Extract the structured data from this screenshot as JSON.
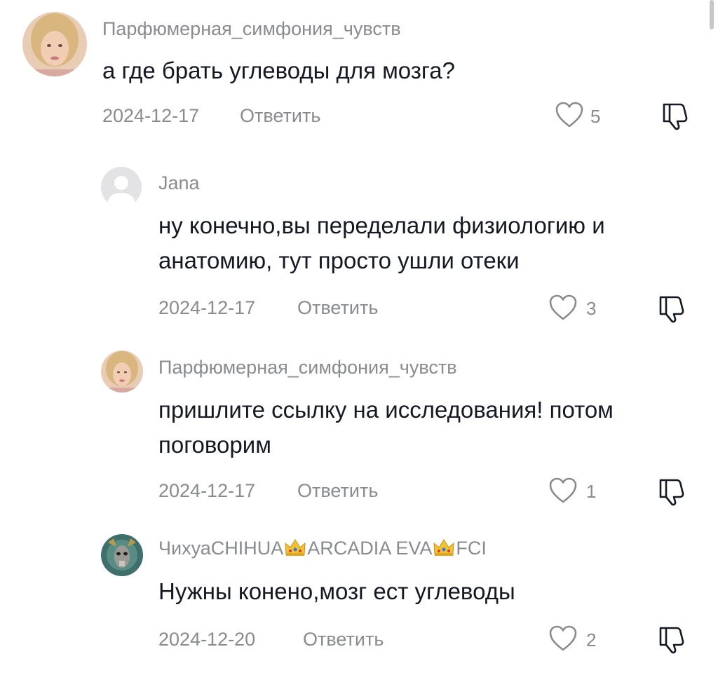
{
  "comments": [
    {
      "username": "Парфюмерная_симфония_чувств",
      "text": "а где брать углеводы для мозга?",
      "date": "2024-12-17",
      "reply_label": "Ответить",
      "likes": "5",
      "like_icon": "heart-outline-icon",
      "dislike_icon": "thumbs-down-icon"
    },
    {
      "username": "Jana",
      "text": "ну конечно,вы переделали физиологию и анатомию, тут просто ушли отеки",
      "date": "2024-12-17",
      "reply_label": "Ответить",
      "likes": "3",
      "like_icon": "heart-outline-icon",
      "dislike_icon": "thumbs-down-icon"
    },
    {
      "username": "Парфюмерная_симфония_чувств",
      "text": "пришлите ссылку на исследования! потом поговорим",
      "date": "2024-12-17",
      "reply_label": "Ответить",
      "likes": "1",
      "like_icon": "heart-outline-icon",
      "dislike_icon": "thumbs-down-icon"
    },
    {
      "username_parts": [
        "ЧихуаCHIHUA",
        "ARCADIA EVA",
        "FCI"
      ],
      "username_icon": "crown-emoji-icon",
      "text": "Нужны конено,мозг ест углеводы",
      "date": "2024-12-20",
      "reply_label": "Ответить",
      "likes": "2",
      "like_icon": "heart-outline-icon",
      "dislike_icon": "thumbs-down-icon"
    }
  ],
  "colors": {
    "primary_text": "#161823",
    "secondary_text": "#8a8b91",
    "background": "#ffffff"
  }
}
